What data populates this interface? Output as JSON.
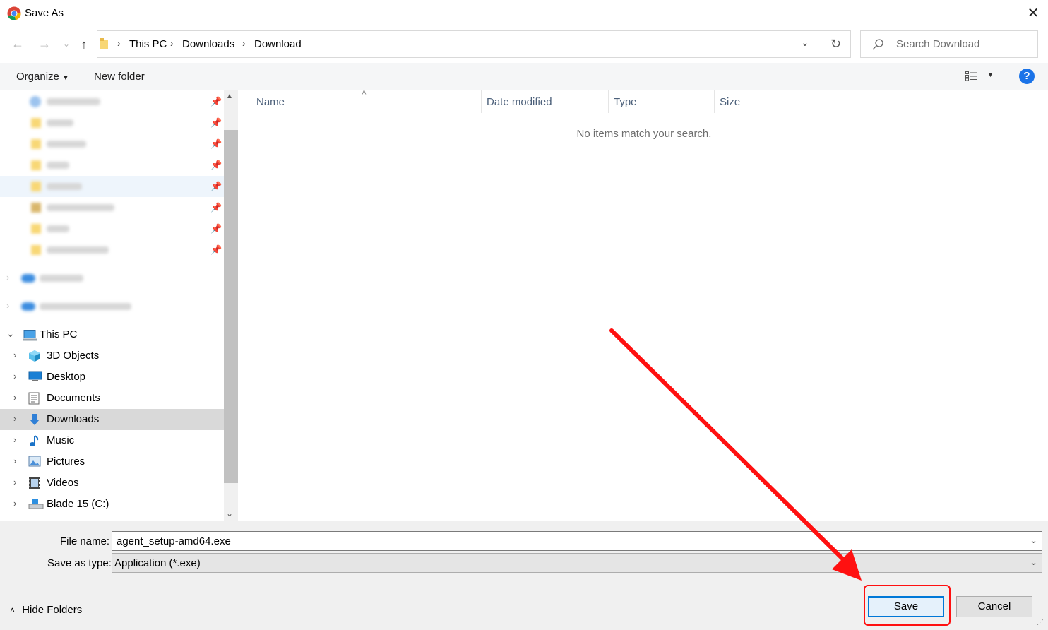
{
  "window": {
    "title": "Save As"
  },
  "address": {
    "crumbs": [
      "This PC",
      "Downloads",
      "Download"
    ]
  },
  "search": {
    "placeholder": "Search Download"
  },
  "toolbar": {
    "organize": "Organize",
    "new_folder": "New folder"
  },
  "nav": {
    "quick_access": [
      {
        "icon": "downloads-icon"
      },
      {
        "icon": "folder-icon"
      },
      {
        "icon": "folder-icon"
      },
      {
        "icon": "folder-icon"
      },
      {
        "icon": "folder-icon",
        "selected": true
      },
      {
        "icon": "shared-folder-icon"
      },
      {
        "icon": "folder-icon"
      },
      {
        "icon": "folder-icon"
      }
    ],
    "cloud": [
      {
        "icon": "cloud-icon"
      },
      {
        "icon": "cloud-icon"
      }
    ],
    "this_pc": "This PC",
    "items": [
      {
        "label": "3D Objects",
        "icon": "3d-objects-icon"
      },
      {
        "label": "Desktop",
        "icon": "desktop-icon"
      },
      {
        "label": "Documents",
        "icon": "documents-icon"
      },
      {
        "label": "Downloads",
        "icon": "downloads-icon",
        "selected": true
      },
      {
        "label": "Music",
        "icon": "music-icon"
      },
      {
        "label": "Pictures",
        "icon": "pictures-icon"
      },
      {
        "label": "Videos",
        "icon": "videos-icon"
      },
      {
        "label": "Blade 15 (C:)",
        "icon": "drive-icon"
      }
    ]
  },
  "columns": [
    "Name",
    "Date modified",
    "Type",
    "Size"
  ],
  "empty_message": "No items match your search.",
  "form": {
    "file_name_label": "File name:",
    "file_name": "agent_setup-amd64.exe",
    "type_label": "Save as type:",
    "type": "Application (*.exe)"
  },
  "buttons": {
    "hide_folders": "Hide Folders",
    "save": "Save",
    "cancel": "Cancel"
  },
  "colors": {
    "accent": "#0078d7",
    "annotation": "#ff1010",
    "selected_row": "#d9d9d9"
  }
}
